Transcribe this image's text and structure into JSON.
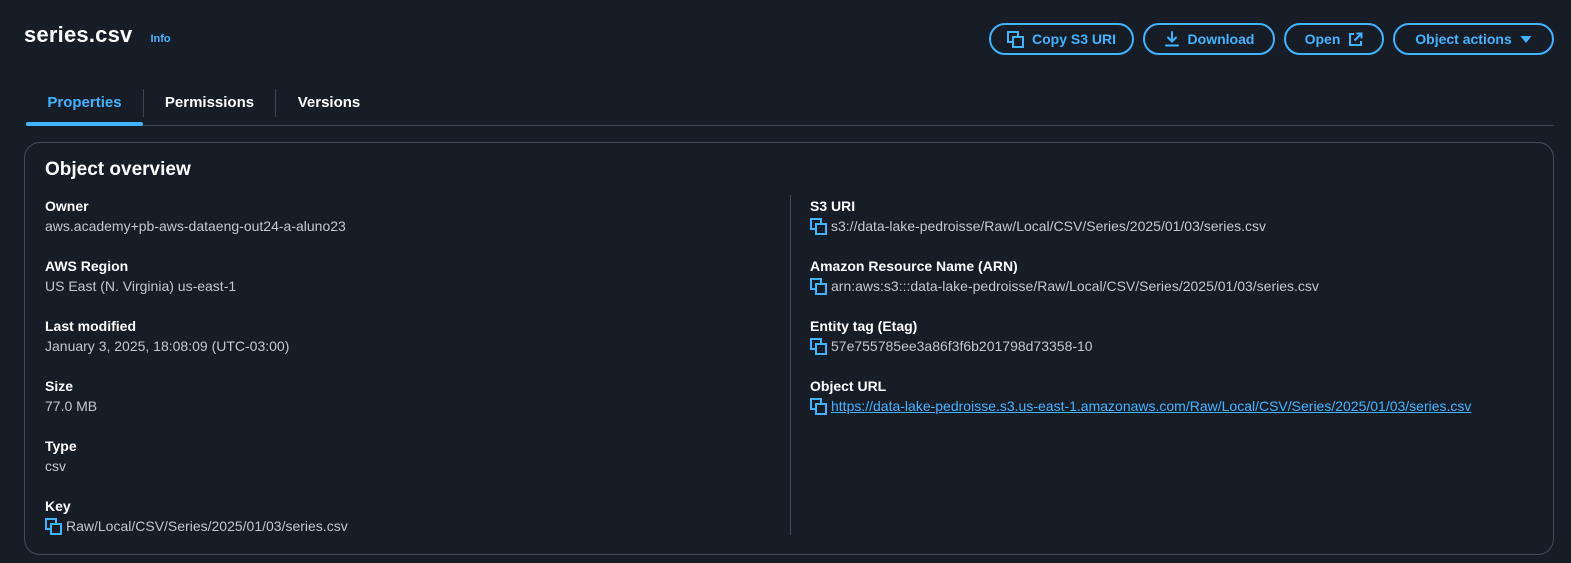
{
  "header": {
    "title": "series.csv",
    "info_label": "Info"
  },
  "actions": {
    "copy_s3_uri": "Copy S3 URI",
    "download": "Download",
    "open": "Open",
    "object_actions": "Object actions"
  },
  "tabs": [
    {
      "label": "Properties",
      "active": true
    },
    {
      "label": "Permissions",
      "active": false
    },
    {
      "label": "Versions",
      "active": false
    }
  ],
  "overview": {
    "title": "Object overview",
    "left": [
      {
        "label": "Owner",
        "value": "aws.academy+pb-aws-dataeng-out24-a-aluno23"
      },
      {
        "label": "AWS Region",
        "value": "US East (N. Virginia) us-east-1"
      },
      {
        "label": "Last modified",
        "value": "January 3, 2025, 18:08:09 (UTC-03:00)"
      },
      {
        "label": "Size",
        "value": "77.0 MB"
      },
      {
        "label": "Type",
        "value": "csv"
      },
      {
        "label": "Key",
        "value": "Raw/Local/CSV/Series/2025/01/03/series.csv"
      }
    ],
    "right": [
      {
        "label": "S3 URI",
        "value": "s3://data-lake-pedroisse/Raw/Local/CSV/Series/2025/01/03/series.csv"
      },
      {
        "label": "Amazon Resource Name (ARN)",
        "value": "arn:aws:s3:::data-lake-pedroisse/Raw/Local/CSV/Series/2025/01/03/series.csv"
      },
      {
        "label": "Entity tag (Etag)",
        "value": "57e755785ee3a86f3f6b201798d73358-10"
      },
      {
        "label": "Object URL",
        "value": "https://data-lake-pedroisse.s3.us-east-1.amazonaws.com/Raw/Local/CSV/Series/2025/01/03/series.csv"
      }
    ]
  },
  "colors": {
    "accent": "#42b4ff",
    "background": "#161d26",
    "border": "#414d5c"
  }
}
